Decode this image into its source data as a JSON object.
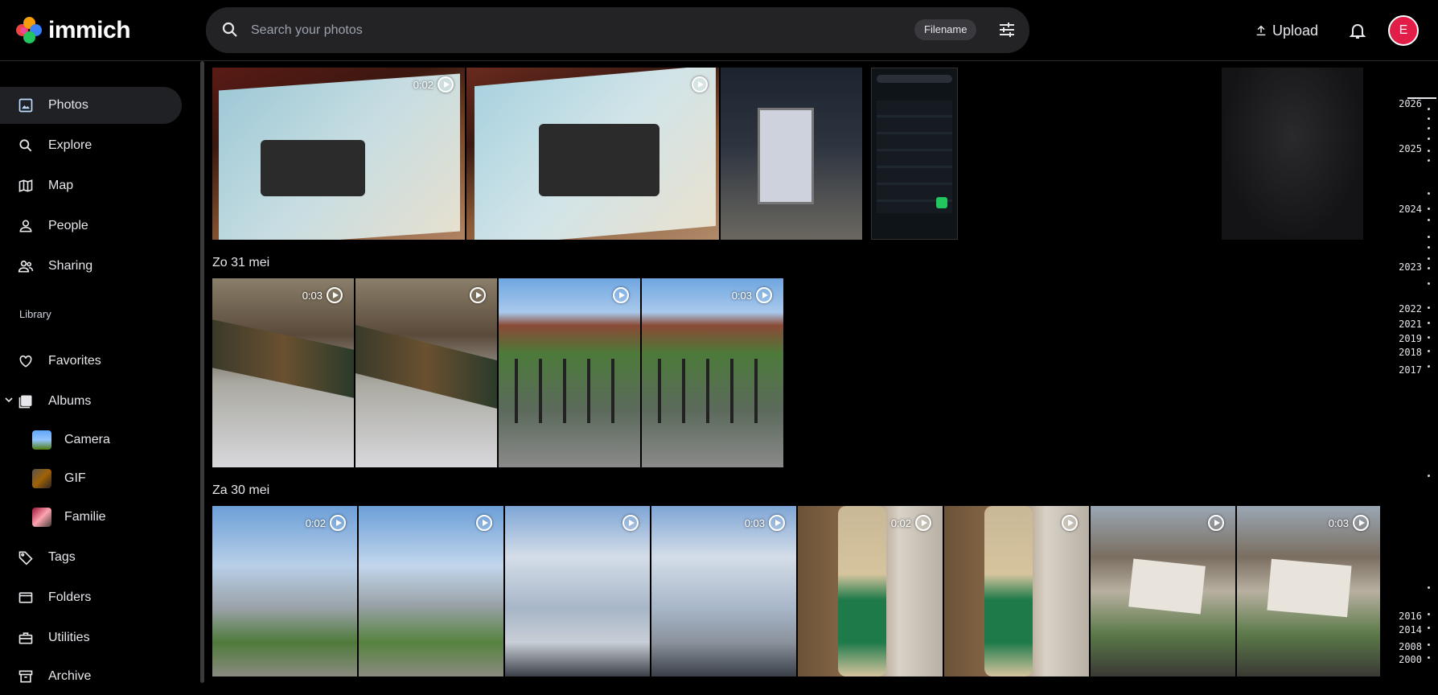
{
  "app": {
    "name": "immich"
  },
  "search": {
    "placeholder": "Search your photos",
    "filter_chip": "Filename"
  },
  "header": {
    "upload_label": "Upload",
    "avatar_initial": "E"
  },
  "sidebar": {
    "items": [
      {
        "label": "Photos",
        "icon": "photos-icon"
      },
      {
        "label": "Explore",
        "icon": "explore-icon"
      },
      {
        "label": "Map",
        "icon": "map-icon"
      },
      {
        "label": "People",
        "icon": "people-icon"
      },
      {
        "label": "Sharing",
        "icon": "sharing-icon"
      }
    ],
    "library_label": "Library",
    "library_items": [
      {
        "label": "Favorites",
        "icon": "heart-icon"
      },
      {
        "label": "Albums",
        "icon": "albums-icon"
      }
    ],
    "albums": [
      {
        "label": "Camera"
      },
      {
        "label": "GIF"
      },
      {
        "label": "Familie"
      }
    ],
    "bottom_items": [
      {
        "label": "Tags",
        "icon": "tag-icon"
      },
      {
        "label": "Folders",
        "icon": "folder-icon"
      },
      {
        "label": "Utilities",
        "icon": "toolbox-icon"
      },
      {
        "label": "Archive",
        "icon": "archive-icon"
      }
    ]
  },
  "groups": [
    {
      "date": "",
      "assets": [
        {
          "duration": "0:02",
          "video": true
        },
        {
          "duration": "",
          "video": true
        },
        {
          "duration": "",
          "video": false
        },
        {
          "duration": "",
          "video": false
        },
        {
          "duration": "",
          "video": false
        }
      ]
    },
    {
      "date": "Zo 31 mei",
      "assets": [
        {
          "duration": "0:03",
          "video": true
        },
        {
          "duration": "",
          "video": true
        },
        {
          "duration": "",
          "video": true
        },
        {
          "duration": "0:03",
          "video": true
        }
      ]
    },
    {
      "date": "Za 30 mei",
      "assets": [
        {
          "duration": "0:02",
          "video": true
        },
        {
          "duration": "",
          "video": true
        },
        {
          "duration": "",
          "video": true
        },
        {
          "duration": "0:03",
          "video": true
        },
        {
          "duration": "0:02",
          "video": true
        },
        {
          "duration": "",
          "video": true
        },
        {
          "duration": "",
          "video": true
        },
        {
          "duration": "0:03",
          "video": true
        }
      ]
    }
  ],
  "timeline": {
    "years": [
      "2026",
      "2025",
      "2024",
      "2023",
      "2022",
      "2021",
      "2019",
      "2018",
      "2017",
      "2016",
      "2014",
      "2008",
      "2000"
    ]
  },
  "colors": {
    "accent": "#e11d48",
    "active_bg": "#1f2125",
    "search_bg": "#232326"
  }
}
